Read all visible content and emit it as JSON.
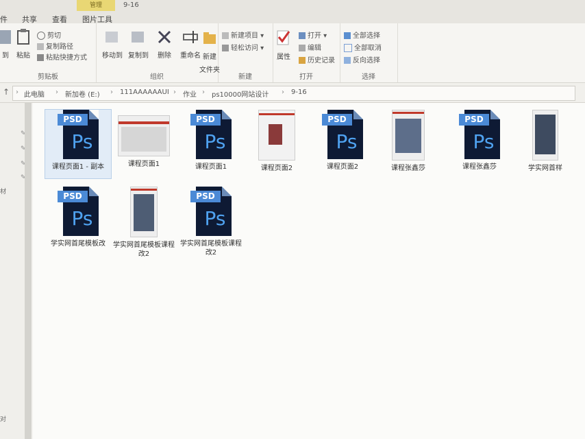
{
  "title": {
    "context_header": "管理",
    "folder": "9-16"
  },
  "tabs": [
    "件",
    "共享",
    "查看",
    "图片工具"
  ],
  "ribbon": {
    "clipboard": {
      "label": "剪贴板",
      "pin_label": "到",
      "paste_label": "粘贴",
      "cut": "剪切",
      "copy_path": "复制路径",
      "paste_shortcut": "粘贴快捷方式"
    },
    "organize": {
      "label": "组织",
      "move_to": "移动到",
      "copy_to": "复制到",
      "delete": "删除",
      "rename": "重命名"
    },
    "new": {
      "label": "新建",
      "new_folder": "新建\n文件夹",
      "new_item": "新建项目",
      "easy_access": "轻松访问"
    },
    "open": {
      "label": "打开",
      "properties": "属性",
      "open": "打开",
      "edit": "编辑",
      "history": "历史记录"
    },
    "select": {
      "label": "选择",
      "select_all": "全部选择",
      "select_none": "全部取消",
      "invert": "反向选择"
    }
  },
  "breadcrumb": [
    "此电脑",
    "新加卷 (E:)",
    "111AAAAAAUI",
    "作业",
    "ps10000网站设计",
    "9-16"
  ],
  "nav_pane": {
    "left_text_1": "材",
    "left_text_2": "对"
  },
  "files": [
    {
      "name": "课程页面1 - 副本",
      "type": "psd",
      "selected": true
    },
    {
      "name": "课程页面1",
      "type": "image"
    },
    {
      "name": "课程页面1",
      "type": "psd"
    },
    {
      "name": "课程页面2",
      "type": "image"
    },
    {
      "name": "课程页面2",
      "type": "psd"
    },
    {
      "name": "课程张鑫莎",
      "type": "image"
    },
    {
      "name": "课程张鑫莎",
      "type": "psd"
    },
    {
      "name": "学实网首样",
      "type": "image"
    },
    {
      "name": "学实网首尾模板改",
      "type": "psd"
    },
    {
      "name": "学实网首尾模板课程改2",
      "type": "image"
    },
    {
      "name": "学实网首尾模板课程改2",
      "type": "psd"
    }
  ],
  "colors": {
    "psd_dark": "#0e1a34",
    "psd_banner": "#4b8ad6",
    "psd_text": "#4fa2f0",
    "context_tab": "#e9d774"
  }
}
